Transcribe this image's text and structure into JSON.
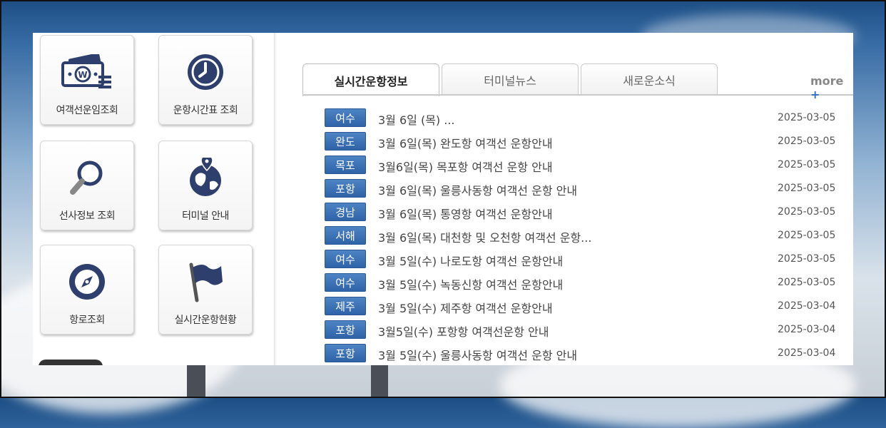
{
  "tiles": [
    {
      "label": "여객선운임조회",
      "icon": "money-icon"
    },
    {
      "label": "운항시간표 조회",
      "icon": "clock-icon"
    },
    {
      "label": "선사정보 조회",
      "icon": "magnifier-icon"
    },
    {
      "label": "터미널 안내",
      "icon": "globe-pin-icon"
    },
    {
      "label": "항로조회",
      "icon": "compass-icon"
    },
    {
      "label": "실시간운항현황",
      "icon": "flag-icon"
    }
  ],
  "tabs": [
    "실시간운항정보",
    "터미널뉴스",
    "새로운소식"
  ],
  "more": {
    "label": "more",
    "plus": "+"
  },
  "notices": [
    {
      "region": "여수",
      "title": "3월  6일 (목) ...",
      "date": "2025-03-05"
    },
    {
      "region": "완도",
      "title": "3월 6일(목) 완도항 여객선 운항안내",
      "date": "2025-03-05"
    },
    {
      "region": "목포",
      "title": "3월6일(목) 목포항 여객선 운항 안내",
      "date": "2025-03-05"
    },
    {
      "region": "포항",
      "title": "3월 6일(목) 울릉사동항 여객선 운항 안내",
      "date": "2025-03-05"
    },
    {
      "region": "경남",
      "title": "3월 6일(목) 통영항 여객선 운항안내",
      "date": "2025-03-05"
    },
    {
      "region": "서해",
      "title": "3월 6일(목) 대천항 및 오천항 여객선 운항...",
      "date": "2025-03-05"
    },
    {
      "region": "여수",
      "title": "3월 5일(수) 나로도항 여객선 운항안내",
      "date": "2025-03-05"
    },
    {
      "region": "여수",
      "title": "3월 5일(수) 녹동신항 여객선 운항안내",
      "date": "2025-03-05"
    },
    {
      "region": "제주",
      "title": "3월 5일(수) 제주항 여객선 운항안내",
      "date": "2025-03-04"
    },
    {
      "region": "포항",
      "title": "3월5일(수) 포항항 여객선운항 안내",
      "date": "2025-03-04"
    },
    {
      "region": "포항",
      "title": "3월 5일(수) 울릉사동항 여객선 운항 안내",
      "date": "2025-03-04"
    }
  ],
  "colors": {
    "badge": "#2f63a8",
    "accent": "#2f6fc9",
    "icon": "#2e3f6e"
  }
}
